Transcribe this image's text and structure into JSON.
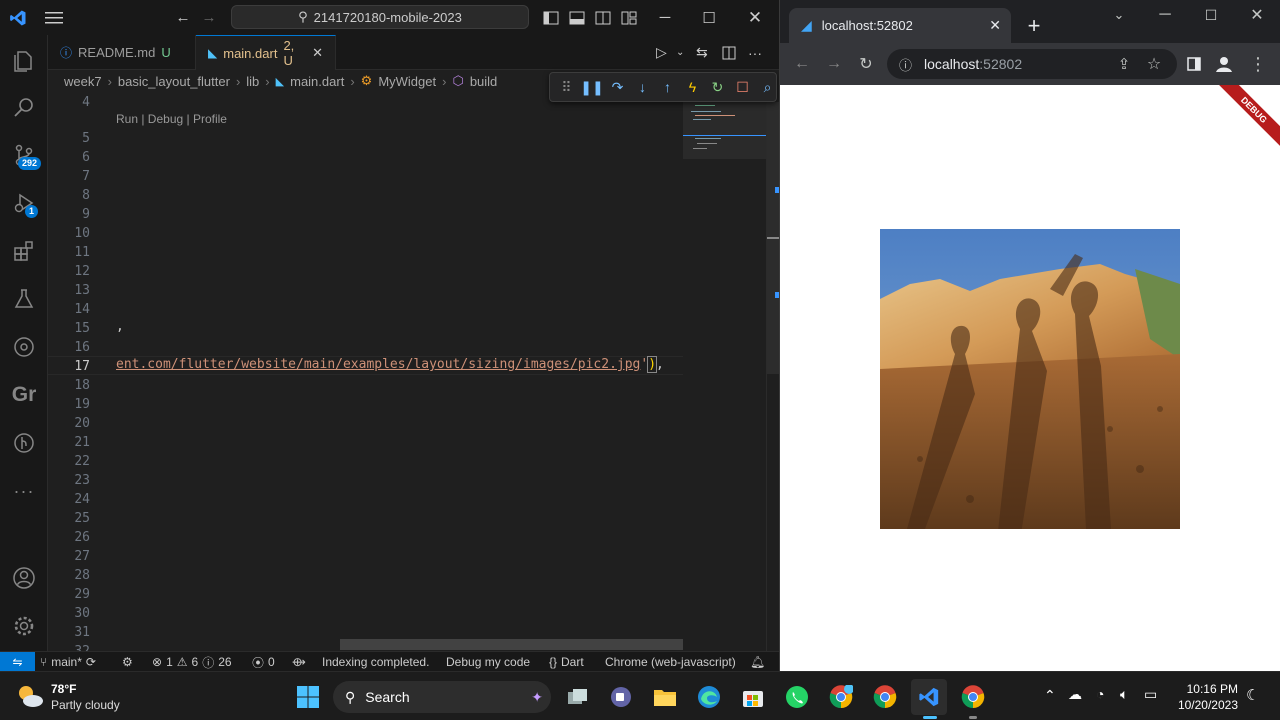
{
  "vscode": {
    "command_center": "2141720180-mobile-2023",
    "tabs": [
      {
        "label": "README.md",
        "status": "U"
      },
      {
        "label": "main.dart",
        "status": "2, U"
      }
    ],
    "breadcrumbs": [
      "week7",
      "basic_layout_flutter",
      "lib",
      "main.dart",
      "MyWidget",
      "build"
    ],
    "codelens": "Run | Debug | Profile",
    "line_numbers": [
      "4",
      "5",
      "6",
      "7",
      "8",
      "9",
      "10",
      "11",
      "12",
      "13",
      "14",
      "15",
      "16",
      "17",
      "18",
      "19",
      "20",
      "21",
      "22",
      "23",
      "24",
      "25",
      "26",
      "27",
      "28",
      "29",
      "30",
      "31",
      "32"
    ],
    "current_line": "17",
    "code_line_15": ",",
    "code_line_17_string": "ent.com/flutter/website/main/examples/layout/sizing/images/pic2.jpg",
    "code_line_17_quote": "'",
    "code_line_17_paren": ")",
    "code_line_17_rest": ",",
    "activity_badges": {
      "source_control": "292",
      "run_debug": "1"
    },
    "activity_gr": "Gr",
    "status": {
      "branch": "main*",
      "errors": "1",
      "warnings": "6",
      "infos": "26",
      "ports": "0",
      "indexing": "Indexing completed.",
      "debug_my_code": "Debug my code",
      "language": "Dart",
      "device": "Chrome (web-javascript)"
    }
  },
  "chrome": {
    "tab_title": "localhost:52802",
    "address_host": "localhost",
    "address_port": ":52802",
    "debug_banner": "DEBUG"
  },
  "taskbar": {
    "weather_temp": "78°F",
    "weather_desc": "Partly cloudy",
    "search_label": "Search",
    "time": "10:16 PM",
    "date": "10/20/2023"
  },
  "colors": {
    "accent": "#0078d4",
    "string": "#ce9178",
    "modified": "#e2c08d",
    "untracked": "#73c991",
    "debug_banner": "#b71c1c"
  }
}
